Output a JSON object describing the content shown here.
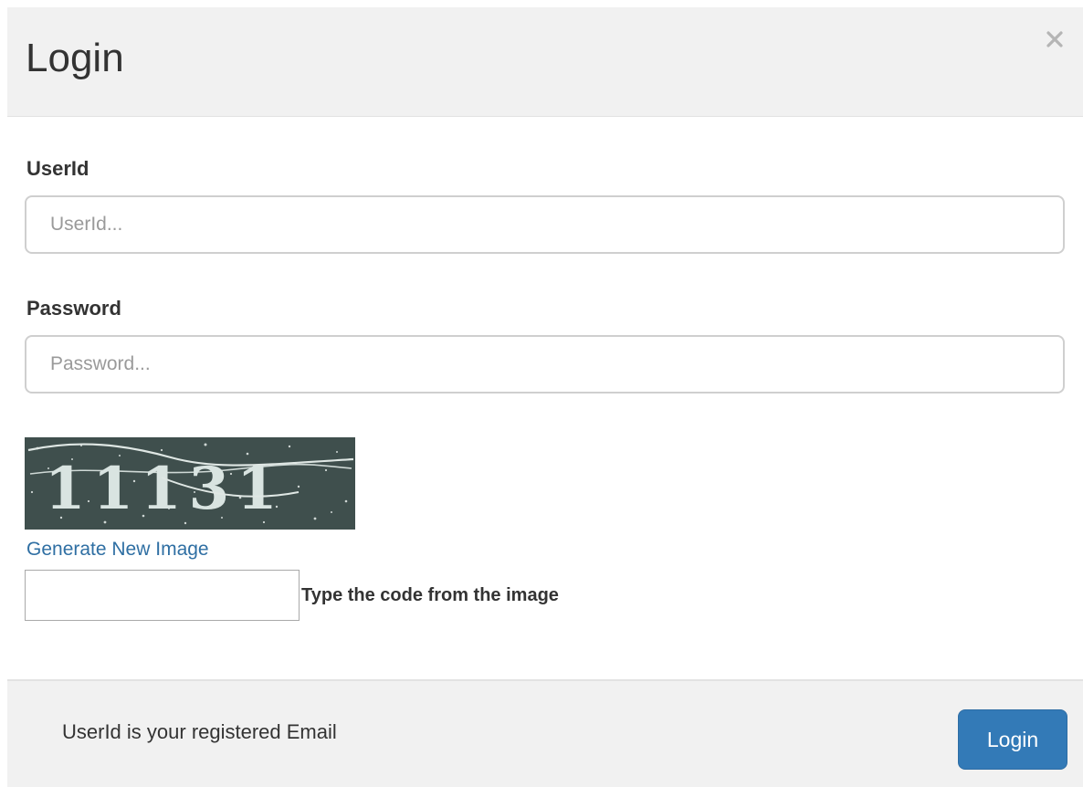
{
  "header": {
    "title": "Login",
    "close_icon": "close-icon"
  },
  "form": {
    "userid": {
      "label": "UserId",
      "value": "",
      "placeholder": "UserId..."
    },
    "password": {
      "label": "Password",
      "value": "",
      "placeholder": "Password..."
    },
    "captcha": {
      "image_text": "11131",
      "generate_link_label": "Generate New Image",
      "code_value": "",
      "code_label": "Type the code from the image"
    }
  },
  "footer": {
    "note": "UserId is your registered Email",
    "login_label": "Login"
  },
  "colors": {
    "header_bg": "#f1f1f1",
    "link": "#2f6fa3",
    "primary_button": "#337ab7",
    "captcha_bg": "#3f4f4d"
  }
}
